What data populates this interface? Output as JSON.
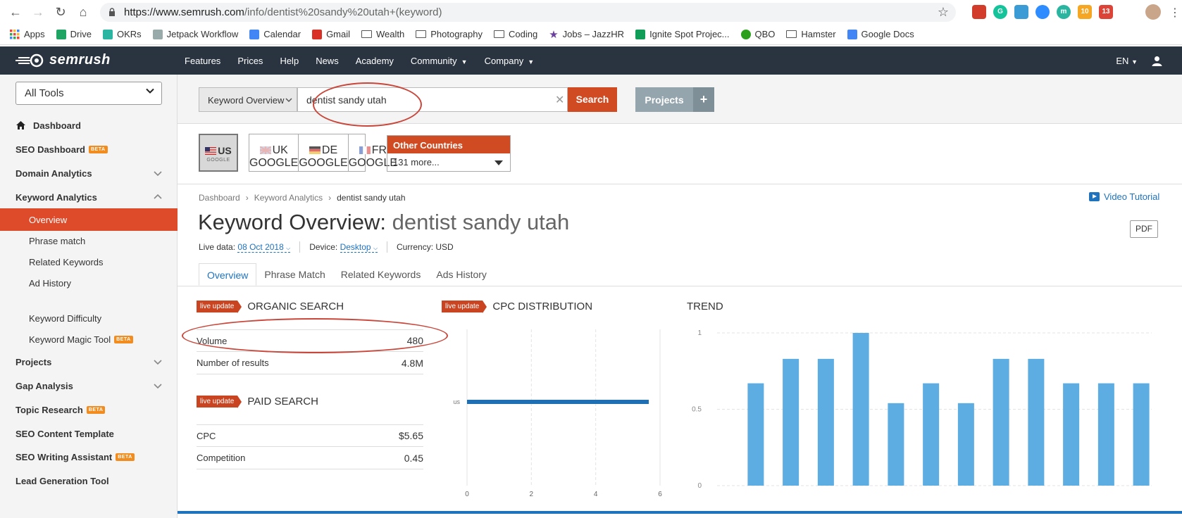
{
  "browser": {
    "url_host": "https://www.semrush.com",
    "url_path": "/info/dentist%20sandy%20utah+(keyword)",
    "extensions": [
      {
        "name": "color-picker-ext-icon",
        "color": "#d23c2a",
        "label": ""
      },
      {
        "name": "grammarly-ext-icon",
        "color": "#15c39a",
        "label": "G"
      },
      {
        "name": "shield-ext-icon",
        "color": "#3a9bd5",
        "label": ""
      },
      {
        "name": "zoom-ext-icon",
        "color": "#2d8cff",
        "label": ""
      },
      {
        "name": "m-ext-icon",
        "color": "#2bb5a0",
        "label": "m"
      },
      {
        "name": "badge10-ext-icon",
        "color": "#f5a623",
        "label": "10"
      },
      {
        "name": "mail-ext-icon",
        "color": "#db4437",
        "label": "13"
      }
    ]
  },
  "bookmarks": [
    {
      "label": "Apps",
      "icon": "apps-grid-icon"
    },
    {
      "label": "Drive",
      "icon": "drive-icon"
    },
    {
      "label": "OKRs",
      "icon": "okrs-icon"
    },
    {
      "label": "Jetpack Workflow",
      "icon": "jetpack-icon"
    },
    {
      "label": "Calendar",
      "icon": "calendar-icon"
    },
    {
      "label": "Gmail",
      "icon": "gmail-icon"
    },
    {
      "label": "Wealth",
      "icon": "folder-icon"
    },
    {
      "label": "Photography",
      "icon": "folder-icon"
    },
    {
      "label": "Coding",
      "icon": "folder-icon"
    },
    {
      "label": "Jobs – JazzHR",
      "icon": "star-icon"
    },
    {
      "label": "Ignite Spot Projec...",
      "icon": "sheets-icon"
    },
    {
      "label": "QBO",
      "icon": "qbo-icon"
    },
    {
      "label": "Hamster",
      "icon": "folder-icon"
    },
    {
      "label": "Google Docs",
      "icon": "docs-icon"
    }
  ],
  "topnav": {
    "logo": "semrush",
    "menu": [
      "Features",
      "Prices",
      "Help",
      "News",
      "Academy",
      "Community",
      "Company"
    ],
    "lang": "EN"
  },
  "sidebar": {
    "tools_select": "All Tools",
    "items": [
      {
        "label": "Dashboard",
        "type": "main"
      },
      {
        "label": "SEO Dashboard",
        "type": "main",
        "badge": "BETA"
      },
      {
        "label": "Domain Analytics",
        "type": "main"
      },
      {
        "label": "Keyword Analytics",
        "type": "main"
      },
      {
        "label": "Overview",
        "type": "sub"
      },
      {
        "label": "Phrase match",
        "type": "sub"
      },
      {
        "label": "Related Keywords",
        "type": "sub"
      },
      {
        "label": "Ad History",
        "type": "sub"
      },
      {
        "label": "Keyword Difficulty",
        "type": "sub"
      },
      {
        "label": "Keyword Magic Tool",
        "type": "sub",
        "badge": "BETA"
      },
      {
        "label": "Projects",
        "type": "main"
      },
      {
        "label": "Gap Analysis",
        "type": "main"
      },
      {
        "label": "Topic Research",
        "type": "main",
        "badge": "BETA"
      },
      {
        "label": "SEO Content Template",
        "type": "main"
      },
      {
        "label": "SEO Writing Assistant",
        "type": "main",
        "badge": "BETA"
      },
      {
        "label": "Lead Generation Tool",
        "type": "main"
      }
    ]
  },
  "search": {
    "db_select": "Keyword Overview",
    "query": "dentist sandy utah",
    "button": "Search",
    "projects": "Projects",
    "plus": "+"
  },
  "countries": {
    "engine": "GOOGLE",
    "us": "US",
    "uk": "UK",
    "de": "DE",
    "fr": "FR",
    "other_title": "Other Countries",
    "other_more": "131 more..."
  },
  "breadcrumb": [
    "Dashboard",
    "Keyword Analytics",
    "dentist sandy utah"
  ],
  "video_tutorial": "Video Tutorial",
  "title": {
    "prefix": "Keyword Overview:",
    "keyword": "dentist sandy utah"
  },
  "pdf": "PDF",
  "meta": {
    "live_label": "Live data:",
    "date": "08 Oct 2018",
    "device_label": "Device:",
    "device": "Desktop",
    "currency": "Currency: USD"
  },
  "tabs": [
    "Overview",
    "Phrase Match",
    "Related Keywords",
    "Ads History"
  ],
  "live_badge": "live update",
  "organic": {
    "title": "ORGANIC SEARCH",
    "volume_label": "Volume",
    "volume": "480",
    "results_label": "Number of results",
    "results": "4.8M"
  },
  "paid": {
    "title": "PAID SEARCH",
    "cpc_label": "CPC",
    "cpc": "$5.65",
    "comp_label": "Competition",
    "comp": "0.45"
  },
  "cpc_chart_title": "CPC DISTRIBUTION",
  "trend_chart_title": "TREND",
  "colors": {
    "accent": "#dd4b2b",
    "link": "#1e73be",
    "bar": "#5dade2",
    "cpc_bar": "#1f6fb5"
  },
  "chart_data": [
    {
      "type": "bar",
      "orientation": "horizontal",
      "title": "CPC DISTRIBUTION",
      "categories": [
        "us"
      ],
      "values": [
        5.65
      ],
      "xlim": [
        0,
        6
      ],
      "xticks": [
        "0",
        "2",
        "4",
        "6"
      ],
      "grid": true
    },
    {
      "type": "bar",
      "title": "TREND",
      "values": [
        0.67,
        0.83,
        0.83,
        1.0,
        0.54,
        0.67,
        0.54,
        0.83,
        0.83,
        0.67,
        0.67,
        0.67
      ],
      "ylim": [
        0,
        1
      ],
      "yticks": [
        "0",
        "0.5",
        "1"
      ],
      "grid": true
    }
  ]
}
